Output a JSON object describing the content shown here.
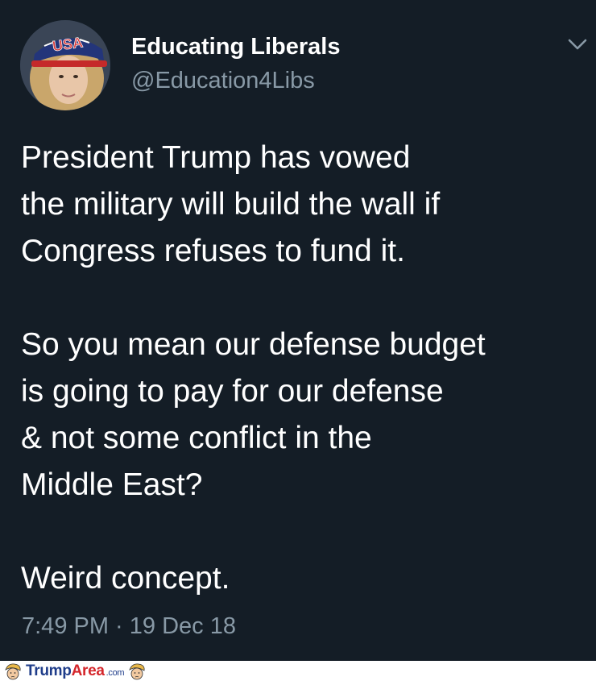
{
  "tweet": {
    "display_name": "Educating Liberals",
    "handle": "@Education4Libs",
    "text_lines": [
      "President Trump has vowed",
      "the military will build the wall if",
      "Congress refuses to fund it.",
      "So you mean our defense budget",
      "is going to pay for our defense",
      "& not some conflict in the",
      "Middle East?",
      "Weird concept."
    ],
    "timestamp": "7:49 PM · 19 Dec 18",
    "avatar_cap_text": "USA"
  },
  "footer": {
    "logo_trump": "Trump",
    "logo_area": "Area",
    "logo_com": ".com"
  },
  "colors": {
    "background": "#141d26",
    "text": "#ffffff",
    "secondary_text": "#8899a6",
    "logo_blue": "#1f3d8a",
    "logo_red": "#d4262b"
  },
  "icons": {
    "caret": "chevron-down-icon",
    "avatar": "user-avatar",
    "logo": "trump-face-icon"
  }
}
